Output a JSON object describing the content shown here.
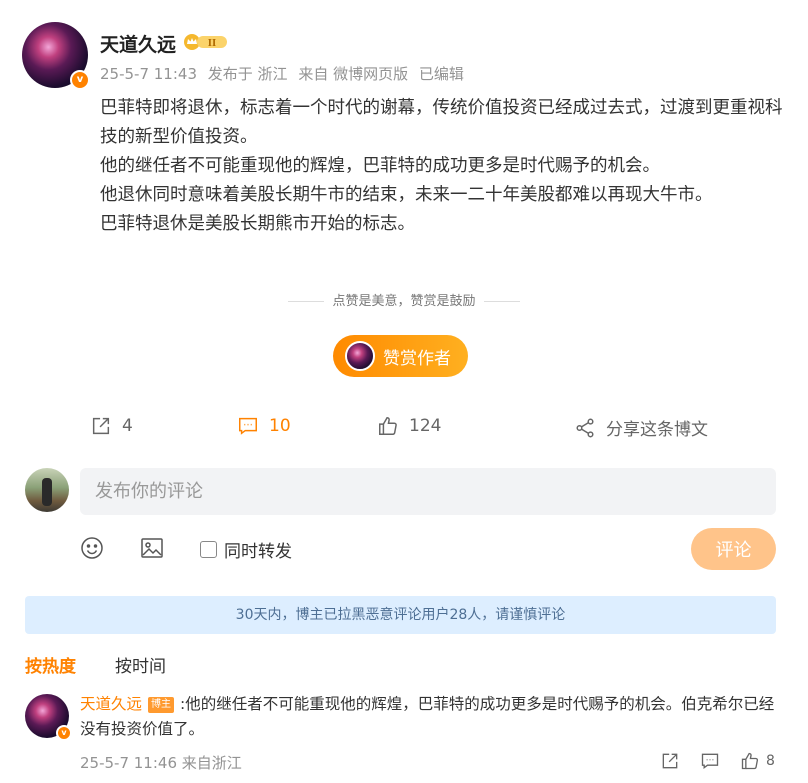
{
  "post": {
    "author": "天道久远",
    "level_badge": "II",
    "verified_mark": "v",
    "meta": {
      "time": "25-5-7 11:43",
      "location": "发布于 浙江",
      "source": "来自 微博网页版",
      "edited": "已编辑"
    },
    "body_lines": [
      "巴菲特即将退休，标志着一个时代的谢幕，传统价值投资已经成过去式，过渡到更重视科技的新型价值投资。",
      "他的继任者不可能重现他的辉煌，巴菲特的成功更多是时代赐予的机会。",
      "他退休同时意味着美股长期牛市的结束，未来一二十年美股都难以再现大牛市。",
      "巴菲特退休是美股长期熊市开始的标志。"
    ],
    "reward_tagline": "点赞是美意，赞赏是鼓励",
    "reward_button": "赞赏作者"
  },
  "actions": {
    "repost_count": "4",
    "comment_count": "10",
    "like_count": "124",
    "share_label": "分享这条博文"
  },
  "comment_box": {
    "placeholder": "发布你的评论",
    "repost_label": "同时转发",
    "submit_label": "评论"
  },
  "notice": "30天内，博主已拉黑恶意评论用户28人，请谨慎评论",
  "sort_tabs": [
    "按热度",
    "按时间"
  ],
  "comments": [
    {
      "author": "天道久远",
      "tag": "博主",
      "text": ":他的继任者不可能重现他的辉煌，巴菲特的成功更多是时代赐予的机会。伯克希尔已经没有投资价值了。",
      "meta": "25-5-7 11:46 来自浙江",
      "like_count": "8"
    }
  ],
  "colors": {
    "accent": "#ff8200",
    "notice_bg": "#ddeeff",
    "notice_text": "#4e6f94",
    "submit_disabled": "#ffc48a"
  },
  "icons": [
    "repost-icon",
    "comment-icon",
    "like-icon",
    "share-icon",
    "emoji-icon",
    "image-icon",
    "verified-icon",
    "crown-badge-icon"
  ]
}
